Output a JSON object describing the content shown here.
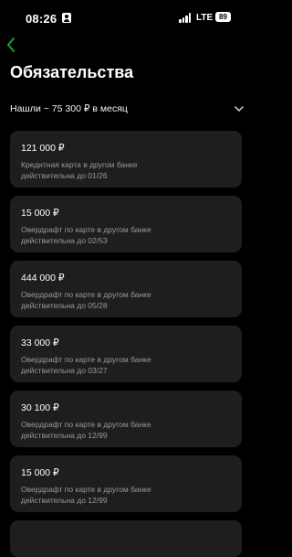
{
  "status_bar": {
    "time": "08:26",
    "network": "LTE",
    "battery": "89"
  },
  "icons": {
    "back": "chevron-left-icon",
    "expand": "chevron-down-icon"
  },
  "colors": {
    "background": "#000000",
    "card": "#1e1e1e",
    "accent": "#21a038",
    "secondary_text": "#9a9a9a"
  },
  "page": {
    "title": "Обязательства",
    "summary": "Нашли ~ 75 300 ₽ в месяц"
  },
  "obligations": [
    {
      "amount": "121 000 ₽",
      "description": "Кредитная карта в другом банке",
      "valid": "действительна до 01/26"
    },
    {
      "amount": "15 000 ₽",
      "description": "Овердрафт по карте в другом банке",
      "valid": "действительна до 02/53"
    },
    {
      "amount": "444 000 ₽",
      "description": "Овердрафт по карте в другом банке",
      "valid": "действительна до 05/28"
    },
    {
      "amount": "33 000 ₽",
      "description": "Овердрафт по карте в другом банке",
      "valid": "действительна до 03/27"
    },
    {
      "amount": "30 100 ₽",
      "description": "Овердрафт по карте в другом банке",
      "valid": "действительна до 12/99"
    },
    {
      "amount": "15 000 ₽",
      "description": "Овердрафт по карте в другом банке",
      "valid": "действительна до 12/99"
    }
  ]
}
